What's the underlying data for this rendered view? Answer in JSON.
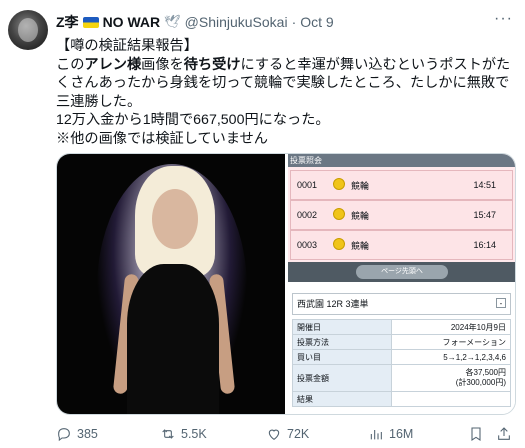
{
  "author": {
    "name": "Z李",
    "name_suffix": "NO WAR",
    "handle": "@ShinjukuSokai",
    "separator": "·",
    "date": "Oct 9"
  },
  "more_label": "···",
  "tweet": {
    "line1": "【噂の検証結果報告】",
    "line2_a": "この",
    "line2_b": "アレン様",
    "line2_c": "画像を",
    "line2_d": "待ち受け",
    "line2_e": "にすると幸運が舞い込むというポストがたくさんあったから身銭を切って競輪で実験したところ、たしかに無敗で三連勝した。",
    "line3": "12万入金から1時間で667,500円になった。",
    "line4": "※他の画像では検証していません"
  },
  "results": {
    "title": "投票照会",
    "rows": [
      {
        "num": "0001",
        "kind": "競輪",
        "time": "14:51"
      },
      {
        "num": "0002",
        "kind": "競輪",
        "time": "15:47"
      },
      {
        "num": "0003",
        "kind": "競輪",
        "time": "16:14"
      }
    ],
    "page_button": "ページ先頭へ"
  },
  "detail": {
    "race": "西武園 12R 3連単",
    "minus": "-",
    "rows": [
      {
        "k": "開催日",
        "v": "2024年10月9日"
      },
      {
        "k": "投票方法",
        "v": "フォーメーション"
      },
      {
        "k": "買い目",
        "v": "5→1,2→1,2,3,4,6"
      },
      {
        "k": "投票金額",
        "v1": "各37,500円",
        "v2": "(計300,000円)"
      },
      {
        "k": "結果",
        "v": ""
      }
    ]
  },
  "actions": {
    "replies": "385",
    "reposts": "5.5K",
    "likes": "72K",
    "views": "16M"
  },
  "colors": {
    "medal": "#f0c419",
    "row_bg": "#fde4e7",
    "muted": "#536471"
  }
}
